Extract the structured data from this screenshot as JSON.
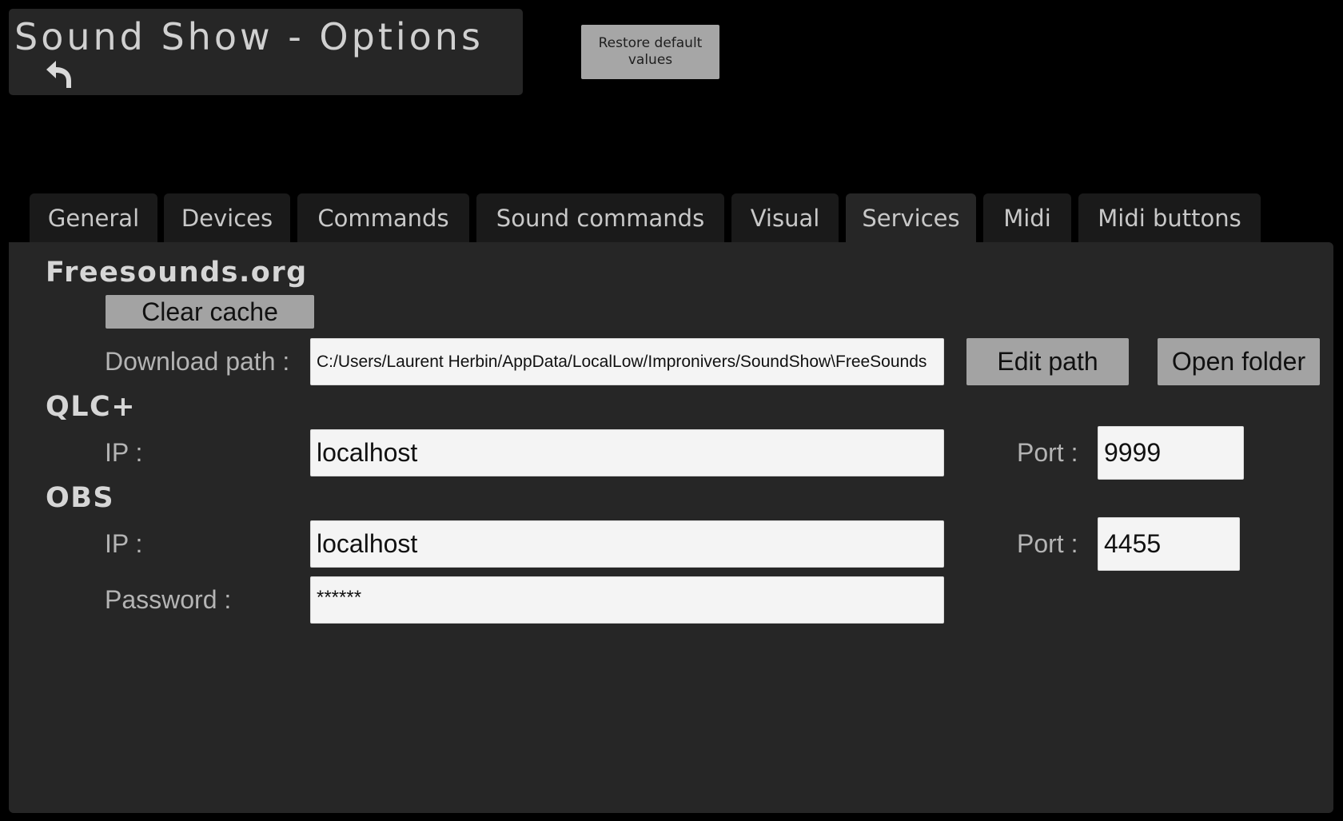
{
  "header": {
    "title": "Sound Show - Options",
    "back_icon": "undo-arrow-icon",
    "restore_label": "Restore default values"
  },
  "tabs": [
    {
      "label": "General",
      "active": false
    },
    {
      "label": "Devices",
      "active": false
    },
    {
      "label": "Commands",
      "active": false
    },
    {
      "label": "Sound commands",
      "active": false
    },
    {
      "label": "Visual",
      "active": false
    },
    {
      "label": "Services",
      "active": true
    },
    {
      "label": "Midi",
      "active": false
    },
    {
      "label": "Midi buttons",
      "active": false
    }
  ],
  "freesounds": {
    "title": "Freesounds.org",
    "clear_cache_label": "Clear cache",
    "download_path_label": "Download path :",
    "download_path_value": "C:/Users/Laurent Herbin/AppData/LocalLow/Impronivers/SoundShow\\FreeSounds",
    "edit_path_label": "Edit path",
    "open_folder_label": "Open folder"
  },
  "qlc": {
    "title": "QLC+",
    "ip_label": "IP  :",
    "ip_value": "localhost",
    "port_label": "Port  :",
    "port_value": "9999"
  },
  "obs": {
    "title": "OBS",
    "ip_label": "IP  :",
    "ip_value": "localhost",
    "port_label": "Port  :",
    "port_value": "4455",
    "password_label": "Password  :",
    "password_value": "******"
  },
  "colors": {
    "background": "#000000",
    "panel": "#262626",
    "tab_inactive": "#1a1a1a",
    "button": "#a3a3a3",
    "field": "#f4f4f4",
    "label_text": "#b4b4b4"
  }
}
